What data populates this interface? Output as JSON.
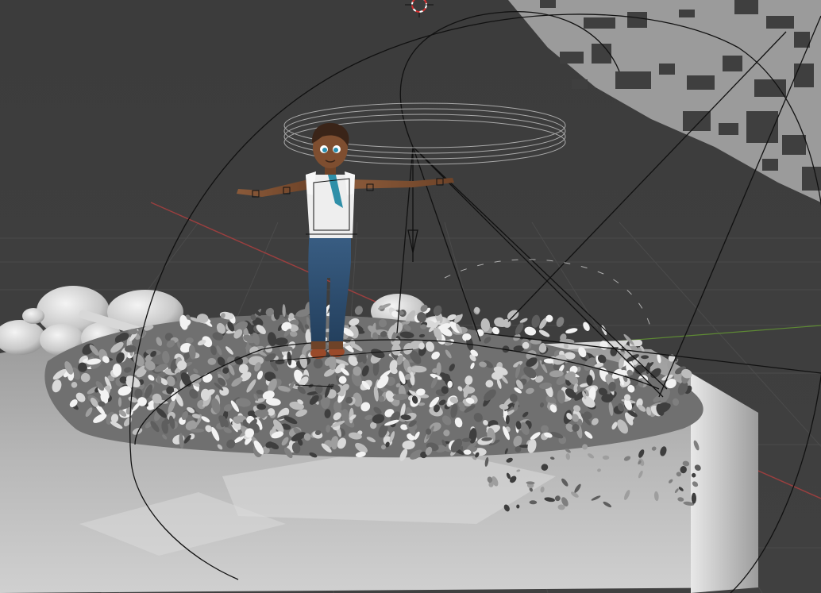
{
  "app": "Blender",
  "viewport": {
    "mode": "3d-viewport",
    "shading": "solid",
    "background_color": "#3d3d3d",
    "grid_color": "#4a4a4a",
    "axis_x_color": "#b34a4a",
    "axis_y_color": "#6a9a3a",
    "wire_color": "#111111"
  },
  "scene_objects": [
    {
      "name": "character",
      "icon": "character-model"
    },
    {
      "name": "ground-platform",
      "icon": "mesh-box"
    },
    {
      "name": "leaf-litter",
      "icon": "particles"
    },
    {
      "name": "rocks",
      "icon": "mesh-sphere"
    },
    {
      "name": "spotlight",
      "icon": "light-spot"
    },
    {
      "name": "area-light-cone",
      "icon": "light-area"
    },
    {
      "name": "3d-cursor",
      "icon": "cursor-target"
    },
    {
      "name": "sky-shadow-texture",
      "icon": "texture-plane"
    },
    {
      "name": "halo-rings",
      "icon": "circle-empty"
    }
  ]
}
